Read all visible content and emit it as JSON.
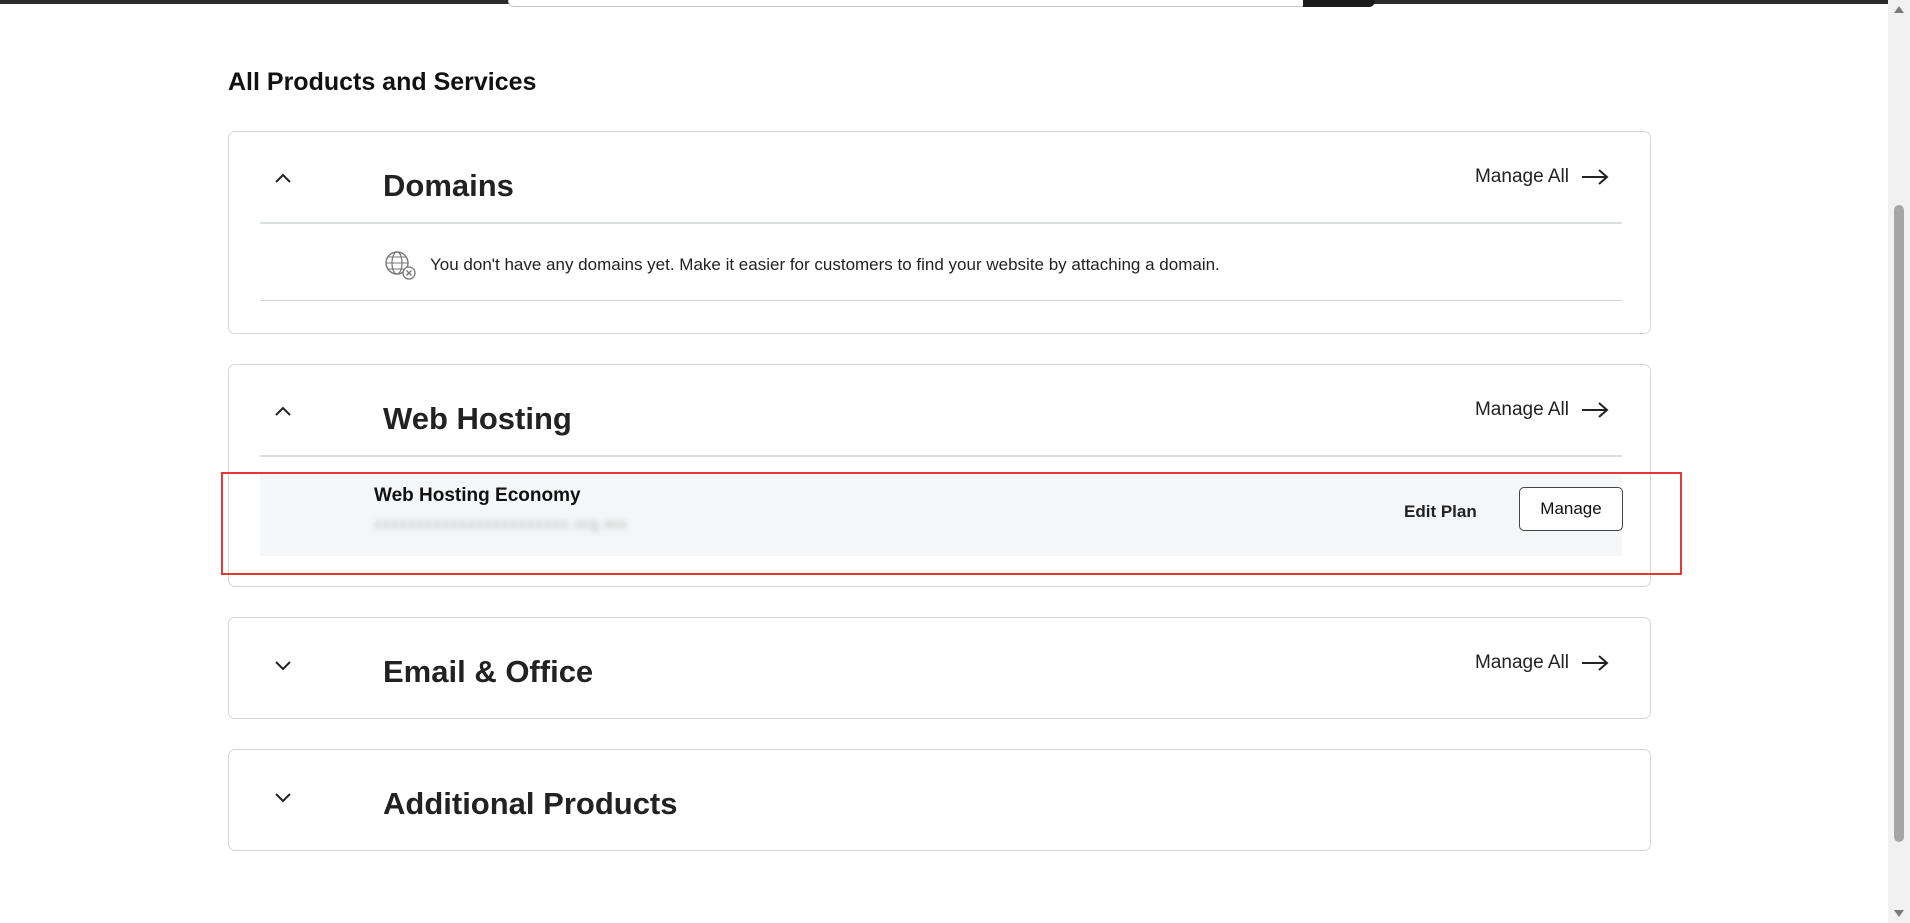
{
  "page": {
    "section_title": "All Products and Services"
  },
  "domains": {
    "title": "Domains",
    "manage_all": "Manage All",
    "empty_message": "You don't have any domains yet. Make it easier for customers to find your website by attaching a domain.",
    "expanded": true
  },
  "web_hosting": {
    "title": "Web Hosting",
    "manage_all": "Manage All",
    "expanded": true,
    "plan": {
      "name": "Web Hosting Economy",
      "domain_blurred": "xxxxxxxxxxxxxxxxxxxxxxx.org.mo",
      "edit_label": "Edit Plan",
      "manage_label": "Manage"
    }
  },
  "email_office": {
    "title": "Email & Office",
    "manage_all": "Manage All",
    "expanded": false
  },
  "additional_products": {
    "title": "Additional Products",
    "expanded": false
  },
  "colors": {
    "highlight": "#e53935",
    "row_background": "#f5f6f7",
    "divider": "#d9dede"
  },
  "icons": {
    "collapse": "chevron-up-icon",
    "expand": "chevron-down-icon",
    "arrow": "arrow-right-icon",
    "no_domain": "globe-x-icon"
  }
}
